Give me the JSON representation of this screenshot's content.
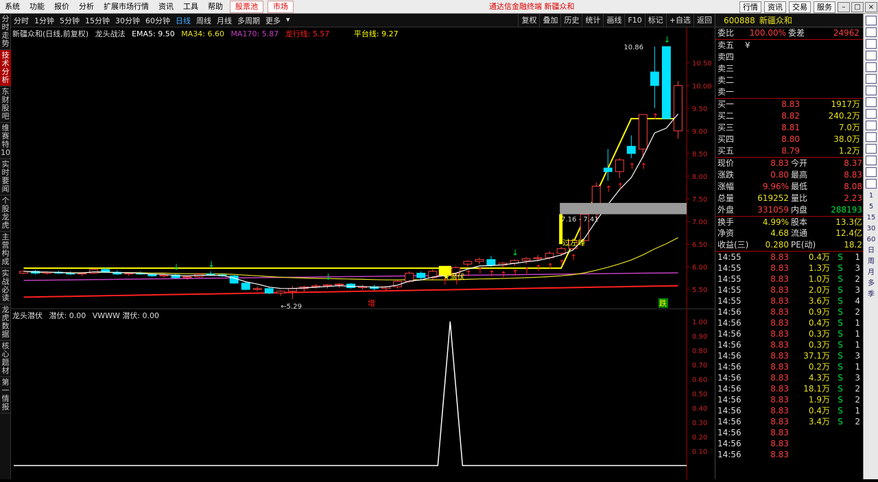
{
  "menu": {
    "items": [
      "系统",
      "功能",
      "报价",
      "分析",
      "扩展市场行情",
      "资讯",
      "工具",
      "帮助"
    ],
    "stock_pool": "股票池",
    "market": "市场",
    "center_title": "通达信金融终端  新疆众和",
    "right_buttons": [
      "行情",
      "资讯",
      "交易",
      "服务"
    ]
  },
  "left_tabs": [
    "分时走势",
    "技术分析",
    "东财股吧",
    "维赛特10",
    "实时要闻",
    "个股龙虎",
    "主营构成",
    "实战必读",
    "龙虎数据",
    "核心题材",
    "第一情报"
  ],
  "periods": [
    "分时",
    "1分钟",
    "5分钟",
    "15分钟",
    "30分钟",
    "60分钟",
    "日线",
    "周线",
    "月线",
    "多周期",
    "更多"
  ],
  "active_period": "日线",
  "tools": [
    "复权",
    "叠加",
    "历史",
    "统计",
    "画线",
    "F10",
    "标记",
    "+自选",
    "返回"
  ],
  "main_legend": {
    "stock": "新疆众和(日线,前复权)",
    "indicator": "龙头战法",
    "ema5": "EMA5: 9.50",
    "ma34": "MA34: 6.60",
    "ma170": "MA170: 5.87",
    "longxing": "龙行线: 5.57",
    "platform": "平台线: 9.27"
  },
  "sub_legend": {
    "name": "龙头潜伏",
    "v1": "潜伏: 0.00",
    "v2": "VWWW  潜伏: 0.00"
  },
  "annotations": {
    "high": "10.86",
    "low": "←5.29",
    "range": "7.16 - 7.41",
    "left_peak": "过左峰",
    "qianfu": "潜伏",
    "zeng": "增",
    "die": "跌"
  },
  "colors": {
    "up": "#ff4040",
    "down": "#00e0ff",
    "ema": "#ffffff",
    "ma34": "#e8e020",
    "ma170": "#c040c0",
    "longxing": "#ff2020",
    "platform": "#ffff00"
  },
  "chart_data": {
    "type": "candlestick",
    "y_ticks": [
      "10.50",
      "10.00",
      "9.50",
      "9.00",
      "8.50",
      "8.00",
      "7.50",
      "7.00",
      "6.50",
      "6.00",
      "5.50"
    ],
    "sub_y_ticks": [
      "1.00",
      "0.90",
      "0.80",
      "0.70",
      "0.60",
      "0.50",
      "0.40",
      "0.30",
      "0.20",
      "0.10"
    ],
    "ylim": [
      5.2,
      10.95
    ],
    "candles": [
      [
        5.86,
        5.92,
        5.84,
        5.9
      ],
      [
        5.9,
        5.93,
        5.83,
        5.86
      ],
      [
        5.86,
        5.9,
        5.83,
        5.88
      ],
      [
        5.88,
        5.91,
        5.84,
        5.86
      ],
      [
        5.86,
        5.9,
        5.82,
        5.84
      ],
      [
        5.84,
        5.88,
        5.8,
        5.86
      ],
      [
        5.86,
        5.96,
        5.84,
        5.94
      ],
      [
        5.94,
        5.98,
        5.86,
        5.88
      ],
      [
        5.88,
        5.92,
        5.82,
        5.84
      ],
      [
        5.84,
        5.88,
        5.8,
        5.86
      ],
      [
        5.86,
        5.9,
        5.82,
        5.84
      ],
      [
        5.84,
        5.86,
        5.78,
        5.8
      ],
      [
        5.8,
        5.84,
        5.76,
        5.82
      ],
      [
        5.82,
        5.84,
        5.74,
        5.76
      ],
      [
        5.76,
        5.8,
        5.72,
        5.78
      ],
      [
        5.78,
        5.86,
        5.76,
        5.84
      ],
      [
        5.84,
        5.9,
        5.8,
        5.82
      ],
      [
        5.82,
        5.86,
        5.78,
        5.8
      ],
      [
        5.8,
        5.82,
        5.62,
        5.64
      ],
      [
        5.64,
        5.68,
        5.48,
        5.5
      ],
      [
        5.5,
        5.56,
        5.46,
        5.52
      ],
      [
        5.52,
        5.54,
        5.4,
        5.42
      ],
      [
        5.42,
        5.48,
        5.36,
        5.46
      ],
      [
        5.46,
        5.58,
        5.29,
        5.52
      ],
      [
        5.52,
        5.58,
        5.46,
        5.56
      ],
      [
        5.56,
        5.62,
        5.52,
        5.58
      ],
      [
        5.58,
        5.62,
        5.52,
        5.6
      ],
      [
        5.6,
        5.64,
        5.54,
        5.62
      ],
      [
        5.62,
        5.64,
        5.52,
        5.54
      ],
      [
        5.54,
        5.6,
        5.5,
        5.56
      ],
      [
        5.56,
        5.6,
        5.48,
        5.52
      ],
      [
        5.52,
        5.58,
        5.48,
        5.56
      ],
      [
        5.56,
        5.7,
        5.52,
        5.68
      ],
      [
        5.68,
        5.9,
        5.64,
        5.86
      ],
      [
        5.86,
        5.9,
        5.72,
        5.76
      ],
      [
        5.76,
        5.94,
        5.72,
        5.9
      ],
      [
        5.9,
        5.98,
        5.82,
        5.86
      ],
      [
        5.86,
        6.02,
        5.82,
        5.98
      ],
      [
        6.06,
        6.14,
        6.0,
        6.12
      ],
      [
        6.12,
        6.2,
        6.06,
        6.16
      ],
      [
        6.16,
        6.24,
        6.0,
        6.04
      ],
      [
        6.04,
        6.1,
        5.98,
        6.08
      ],
      [
        6.08,
        6.16,
        6.02,
        6.14
      ],
      [
        6.14,
        6.22,
        6.06,
        6.18
      ],
      [
        6.18,
        6.26,
        6.12,
        6.2
      ],
      [
        6.2,
        6.34,
        6.16,
        6.3
      ],
      [
        6.3,
        6.44,
        6.24,
        6.4
      ],
      [
        6.4,
        6.62,
        6.36,
        6.58
      ],
      [
        6.58,
        7.16,
        6.56,
        7.16
      ],
      [
        7.4,
        7.86,
        7.3,
        7.78
      ],
      [
        8.18,
        8.6,
        7.9,
        8.1
      ],
      [
        8.1,
        8.4,
        7.96,
        8.36
      ],
      [
        8.66,
        8.9,
        8.4,
        8.5
      ],
      [
        8.6,
        9.36,
        8.4,
        9.36
      ],
      [
        10.3,
        10.86,
        9.5,
        10.0
      ],
      [
        10.86,
        10.86,
        9.27,
        9.27
      ],
      [
        9.0,
        10.1,
        8.83,
        10.0
      ]
    ],
    "sub_series": [
      {
        "name": "潜伏",
        "x_index": 46,
        "peak": 1.0
      }
    ],
    "last_price": 8.83
  },
  "quote": {
    "code": "600888",
    "name": "新疆众和",
    "weibi_label": "委比",
    "weibi": "100.00%",
    "weicha_label": "委差",
    "weicha": "24962",
    "sell": [
      {
        "label": "卖五",
        "price": "¥",
        "vol": ""
      },
      {
        "label": "卖四",
        "price": "",
        "vol": ""
      },
      {
        "label": "卖三",
        "price": "",
        "vol": ""
      },
      {
        "label": "卖二",
        "price": "",
        "vol": ""
      },
      {
        "label": "卖一",
        "price": "",
        "vol": ""
      }
    ],
    "buy": [
      {
        "label": "买一",
        "price": "8.83",
        "vol": "1917万"
      },
      {
        "label": "买二",
        "price": "8.82",
        "vol": "240.2万"
      },
      {
        "label": "买三",
        "price": "8.81",
        "vol": "7.0万"
      },
      {
        "label": "买四",
        "price": "8.80",
        "vol": "38.0万"
      },
      {
        "label": "买五",
        "price": "8.79",
        "vol": "1.2万"
      }
    ],
    "stats": [
      {
        "l1": "现价",
        "v1": "8.83",
        "l2": "今开",
        "v2": "8.37",
        "c1": "#ff4040",
        "c2": "#ff4040"
      },
      {
        "l1": "涨跌",
        "v1": "0.80",
        "l2": "最高",
        "v2": "8.83",
        "c1": "#ff4040",
        "c2": "#ff4040"
      },
      {
        "l1": "涨幅",
        "v1": "9.96%",
        "l2": "最低",
        "v2": "8.08",
        "c1": "#ff4040",
        "c2": "#ff4040"
      },
      {
        "l1": "总量",
        "v1": "619252",
        "l2": "量比",
        "v2": "2.23",
        "c1": "#e8e020",
        "c2": "#ff4040"
      },
      {
        "l1": "外盘",
        "v1": "331059",
        "l2": "内盘",
        "v2": "288193",
        "c1": "#ff4040",
        "c2": "#00e040"
      },
      {
        "l1": "换手",
        "v1": "4.99%",
        "l2": "股本",
        "v2": "13.3亿",
        "c1": "#e8e020",
        "c2": "#e8e020"
      },
      {
        "l1": "净资",
        "v1": "4.68",
        "l2": "流通",
        "v2": "12.4亿",
        "c1": "#e8e020",
        "c2": "#e8e020"
      },
      {
        "l1": "收益(三)",
        "v1": "0.280",
        "l2": "PE(动)",
        "v2": "18.2",
        "c1": "#e8e020",
        "c2": "#e8e020"
      }
    ],
    "ticks": [
      {
        "t": "14:55",
        "p": "8.83",
        "v": "0.4万",
        "f": "S",
        "n": "1"
      },
      {
        "t": "14:55",
        "p": "8.83",
        "v": "1.3万",
        "f": "S",
        "n": "3"
      },
      {
        "t": "14:55",
        "p": "8.83",
        "v": "1.0万",
        "f": "S",
        "n": "2"
      },
      {
        "t": "14:55",
        "p": "8.83",
        "v": "2.0万",
        "f": "S",
        "n": "3"
      },
      {
        "t": "14:55",
        "p": "8.83",
        "v": "3.6万",
        "f": "S",
        "n": "4"
      },
      {
        "t": "14:56",
        "p": "8.83",
        "v": "0.9万",
        "f": "S",
        "n": "2"
      },
      {
        "t": "14:56",
        "p": "8.83",
        "v": "0.4万",
        "f": "S",
        "n": "1"
      },
      {
        "t": "14:56",
        "p": "8.83",
        "v": "0.3万",
        "f": "S",
        "n": "1"
      },
      {
        "t": "14:56",
        "p": "8.83",
        "v": "0.3万",
        "f": "S",
        "n": "1"
      },
      {
        "t": "14:56",
        "p": "8.83",
        "v": "37.1万",
        "f": "S",
        "n": "3"
      },
      {
        "t": "14:56",
        "p": "8.83",
        "v": "0.2万",
        "f": "S",
        "n": "1"
      },
      {
        "t": "14:56",
        "p": "8.83",
        "v": "4.3万",
        "f": "S",
        "n": "3"
      },
      {
        "t": "14:56",
        "p": "8.83",
        "v": "18.1万",
        "f": "S",
        "n": "2"
      },
      {
        "t": "14:56",
        "p": "8.83",
        "v": "1.9万",
        "f": "S",
        "n": "2"
      },
      {
        "t": "14:56",
        "p": "8.83",
        "v": "0.4万",
        "f": "S",
        "n": "1"
      },
      {
        "t": "14:56",
        "p": "8.83",
        "v": "3.4万",
        "f": "S",
        "n": "2"
      },
      {
        "t": "14:56",
        "p": "8.83",
        "v": "",
        "f": "",
        "n": ""
      },
      {
        "t": "14:56",
        "p": "8.83",
        "v": "",
        "f": "",
        "n": ""
      },
      {
        "t": "14:56",
        "p": "8.83",
        "v": "",
        "f": "",
        "n": ""
      }
    ]
  },
  "right_bar": {
    "labels": [
      "1",
      "5",
      "15",
      "30",
      "60",
      "日",
      "周",
      "月",
      "多",
      "季"
    ]
  }
}
